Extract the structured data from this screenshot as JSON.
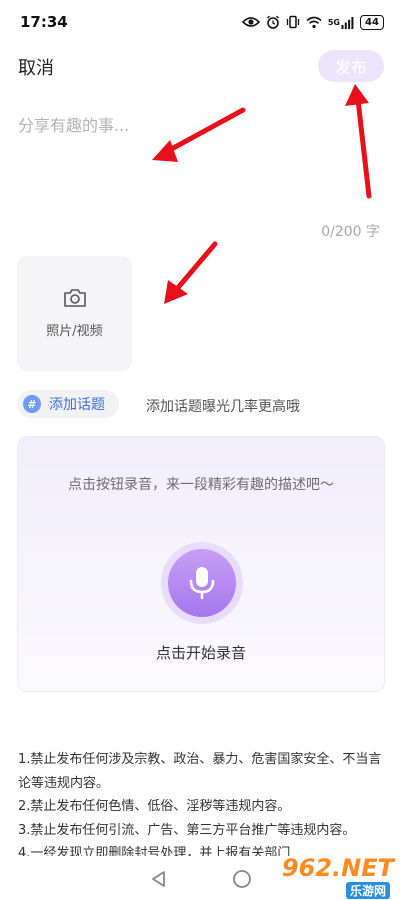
{
  "status_bar": {
    "time": "17:34",
    "network": "5G",
    "battery": "44"
  },
  "header": {
    "cancel_label": "取消",
    "publish_label": "发布"
  },
  "editor": {
    "placeholder": "分享有趣的事...",
    "value": "",
    "char_count": "0/200 字"
  },
  "media": {
    "label": "照片/视频",
    "icon": "camera-icon"
  },
  "topic": {
    "badge": "#",
    "label": "添加话题",
    "hint": "添加话题曝光几率更高哦"
  },
  "record": {
    "prompt": "点击按钮录音，来一段精彩有趣的描述吧～",
    "start_label": "点击开始录音",
    "icon": "microphone-icon"
  },
  "rules": [
    "1.禁止发布任何涉及宗教、政治、暴力、危害国家安全、不当言论等违规内容。",
    "2.禁止发布任何色情、低俗、淫秽等违规内容。",
    "3.禁止发布任何引流、广告、第三方平台推广等违规内容。",
    "4.一经发现立即删除封号处理，并上报有关部门"
  ],
  "nav_bar": {
    "icons": [
      "back-triangle-icon",
      "home-circle-icon"
    ]
  },
  "watermark": {
    "text": "962.NET",
    "sub": "乐游网"
  },
  "colors": {
    "publish_bg": "#ebe4fb",
    "topic_text": "#3d6fd6",
    "mic_gradient_top": "#c79ef4",
    "mic_gradient_bottom": "#a677ec",
    "annotation_arrow": "#e8101a"
  }
}
